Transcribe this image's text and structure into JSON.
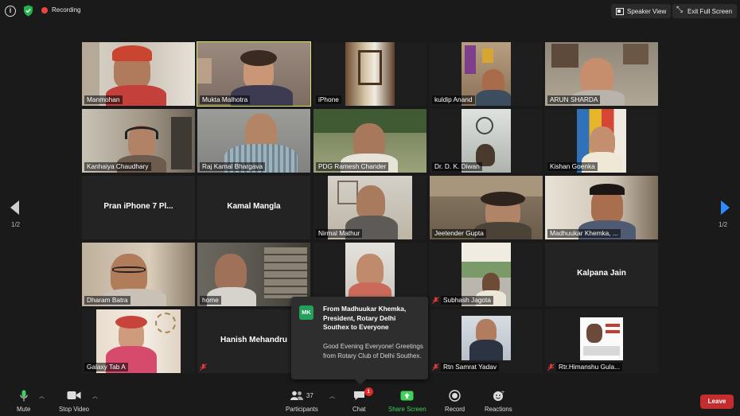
{
  "topbar": {
    "recording_label": "Recording",
    "speaker_view_label": "Speaker View",
    "exit_full_screen_label": "Exit Full Screen"
  },
  "participants": [
    {
      "name": "Manmohan"
    },
    {
      "name": "Mukta Malhotra"
    },
    {
      "name": "iPhone"
    },
    {
      "name": "kuldip Anand"
    },
    {
      "name": "ARUN SHARDA"
    },
    {
      "name": "Kanhaiya Chaudhary"
    },
    {
      "name": "Raj Kamal Bhargava"
    },
    {
      "name": "PDG Ramesh Chander"
    },
    {
      "name": "Dr. D. K. Diwan"
    },
    {
      "name": "Kishan Goenka"
    },
    {
      "name": "Pran iPhone 7 Pl..."
    },
    {
      "name": "Kamal Mangla"
    },
    {
      "name": "Nirmal Mathur"
    },
    {
      "name": "Jeetender Gupta"
    },
    {
      "name": "Madhuukar Khemka, ..."
    },
    {
      "name": "Dharam Batra"
    },
    {
      "name": "home"
    },
    {
      "name": ""
    },
    {
      "name": "Subhash Jagota"
    },
    {
      "name": "Kalpana Jain"
    },
    {
      "name": "Galaxy Tab A"
    },
    {
      "name": "Hanish Mehandru"
    },
    {
      "name": "Rtn Samrat Yadav"
    },
    {
      "name": "Rtr.Himanshu Gula..."
    }
  ],
  "pagination": {
    "left": "1/2",
    "right": "1/2"
  },
  "chat_popup": {
    "avatar_initials": "MK",
    "from": "From Madhuukar Khemka, President, Rotary Delhi Southex to Everyone",
    "message": "Good Evening Everyone! Greetings from Rotary Club of Delhi Southex."
  },
  "toolbar": {
    "mute_label": "Mute",
    "stop_video_label": "Stop Video",
    "participants_label": "Participants",
    "participants_count": "37",
    "chat_label": "Chat",
    "chat_badge": "1",
    "share_screen_label": "Share Screen",
    "record_label": "Record",
    "reactions_label": "Reactions",
    "leave_label": "Leave"
  },
  "colors": {
    "active_speaker_border": "#d8e36a",
    "share_green": "#3fd15b",
    "leave_red": "#c42d2d",
    "next_arrow_blue": "#2d8cff",
    "chat_avatar_green": "#23a05a"
  }
}
